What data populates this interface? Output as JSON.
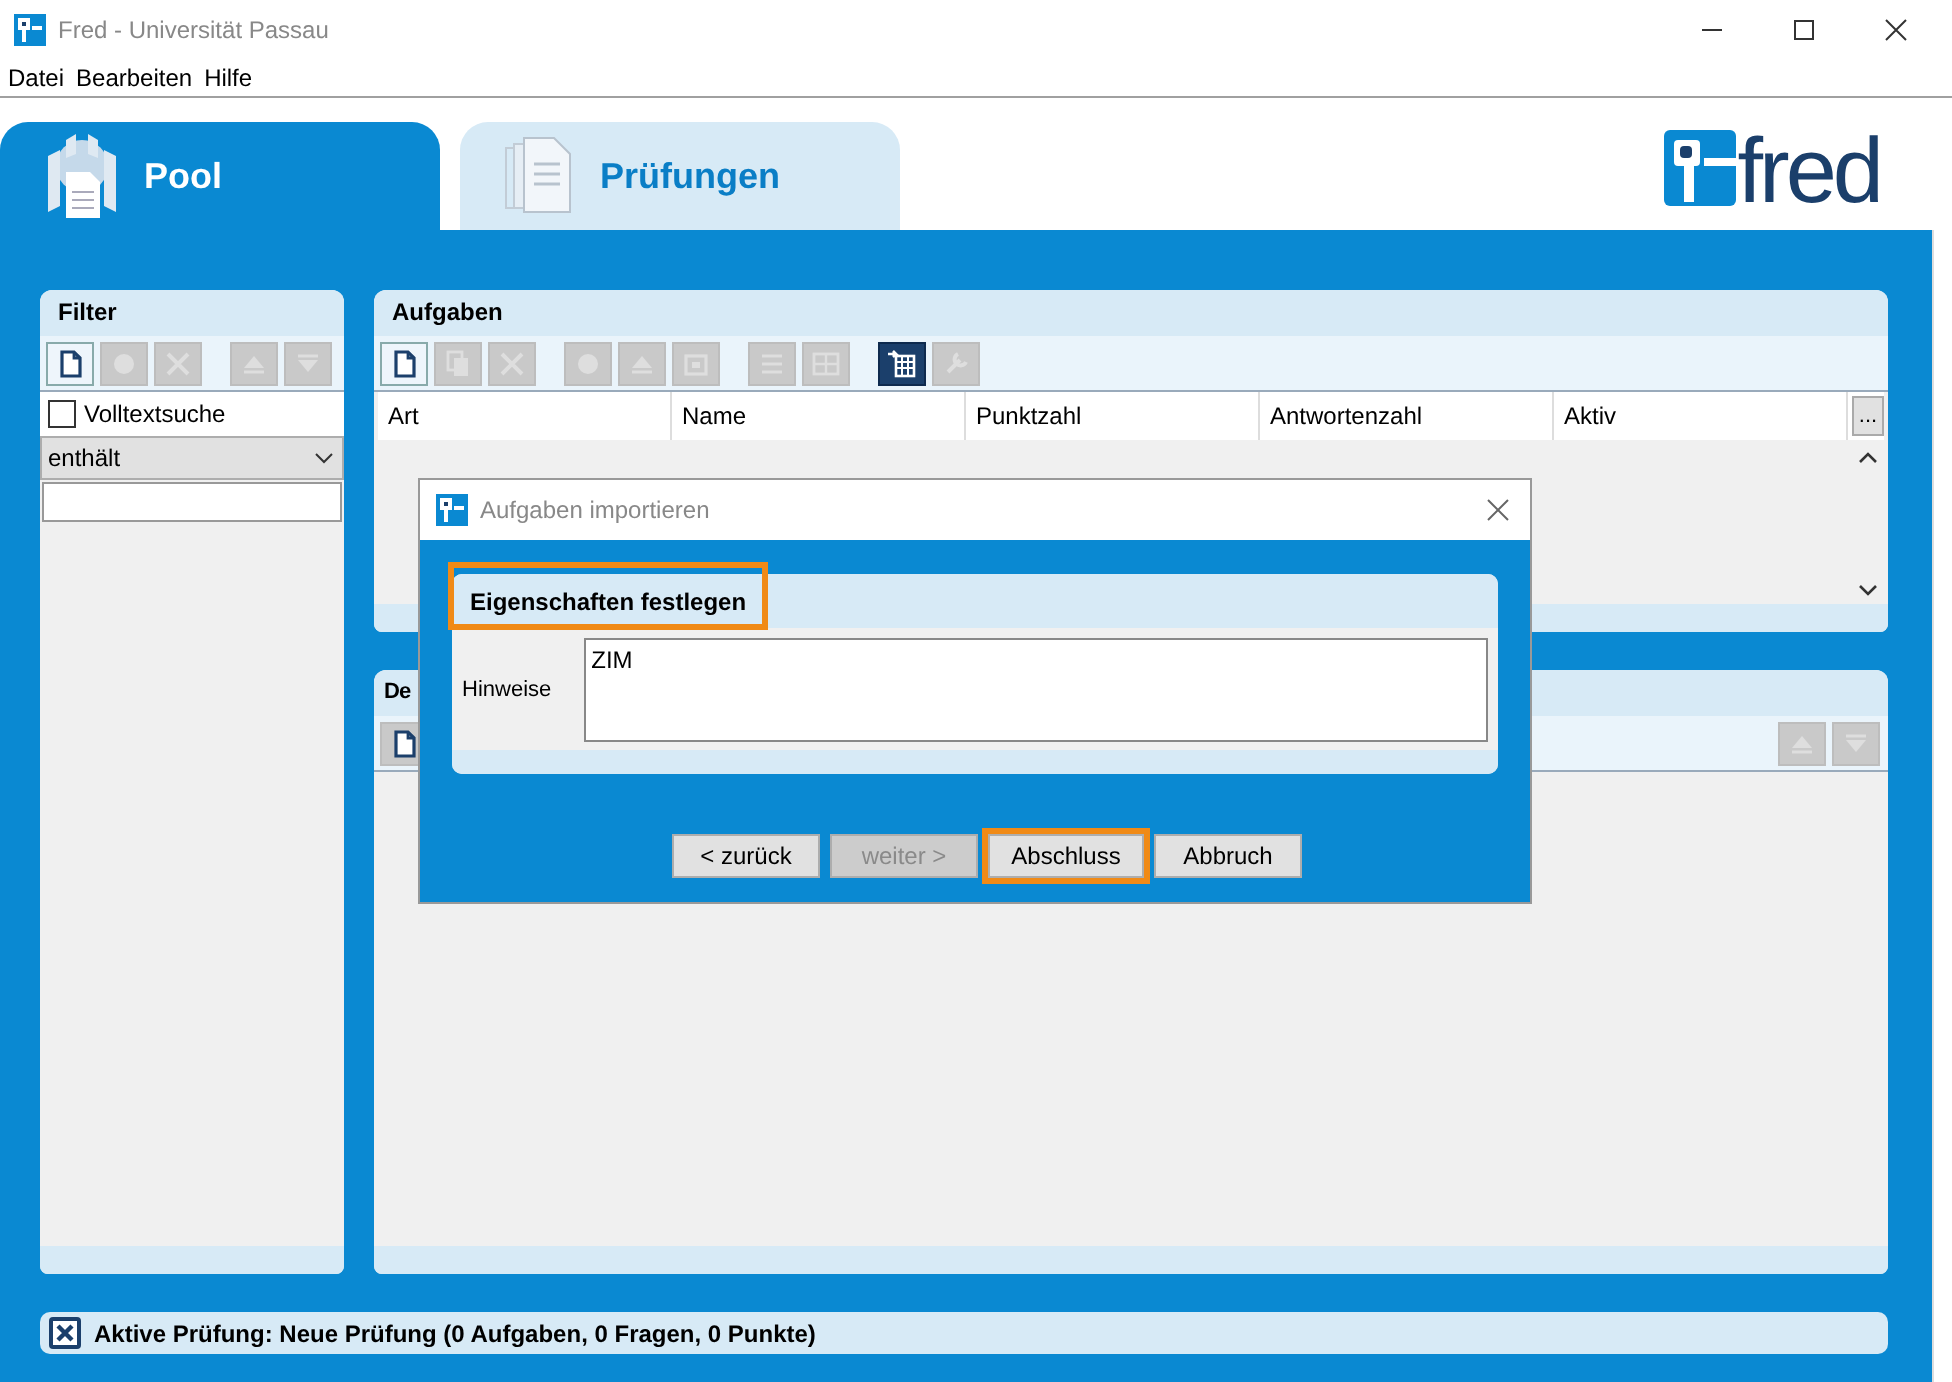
{
  "window": {
    "title": "Fred - Universität Passau"
  },
  "menu": [
    "Datei",
    "Bearbeiten",
    "Hilfe"
  ],
  "tabs": [
    {
      "label": "Pool",
      "kind": "pool",
      "selected": true
    },
    {
      "label": "Prüfungen",
      "kind": "exams",
      "selected": false
    }
  ],
  "logo": {
    "text": "fred"
  },
  "filter": {
    "title": "Filter",
    "toolbar": [
      [
        {
          "kind": "new",
          "disabled": false
        },
        {
          "kind": "edit",
          "disabled": true
        },
        {
          "kind": "delete",
          "disabled": true
        }
      ],
      [
        {
          "kind": "up",
          "disabled": true
        },
        {
          "kind": "down",
          "disabled": true
        }
      ]
    ],
    "fulltext": {
      "label": "Volltextsuche",
      "checked": false
    },
    "mode": {
      "value": "enthält"
    }
  },
  "tasks": {
    "title": "Aufgaben",
    "toolbar": [
      [
        {
          "kind": "new",
          "disabled": false
        },
        {
          "kind": "copy",
          "disabled": true
        },
        {
          "kind": "delete",
          "disabled": true
        }
      ],
      [
        {
          "kind": "edit",
          "disabled": true
        },
        {
          "kind": "up",
          "disabled": true
        },
        {
          "kind": "box",
          "disabled": true
        }
      ],
      [
        {
          "kind": "list",
          "disabled": true
        },
        {
          "kind": "split",
          "disabled": true
        }
      ],
      [
        {
          "kind": "import",
          "disabled": false
        },
        {
          "kind": "tools",
          "disabled": true
        }
      ]
    ],
    "columns": [
      "Art",
      "Name",
      "Punktzahl",
      "Antwortenzahl",
      "Aktiv"
    ],
    "more_button": "..."
  },
  "details": {
    "title": "De",
    "toolbar_left": [
      {
        "kind": "new",
        "disabled": true
      }
    ],
    "toolbar_right": [
      {
        "kind": "up",
        "disabled": true
      },
      {
        "kind": "down",
        "disabled": true
      }
    ]
  },
  "status_bar": {
    "text": "Aktive Prüfung: Neue Prüfung (0 Aufgaben, 0 Fragen, 0 Punkte)"
  },
  "dialog": {
    "title": "Aufgaben importieren",
    "section": {
      "title": "Eigenschaften festlegen",
      "highlighted": true
    },
    "field": {
      "label": "Hinweise",
      "value": "ZIM"
    },
    "buttons": [
      {
        "label": "< zurück",
        "disabled": false,
        "highlighted": false
      },
      {
        "label": "weiter >",
        "disabled": true,
        "highlighted": false
      },
      {
        "label": "Abschluss",
        "disabled": false,
        "highlighted": true
      },
      {
        "label": "Abbruch",
        "disabled": false,
        "highlighted": false
      }
    ]
  }
}
